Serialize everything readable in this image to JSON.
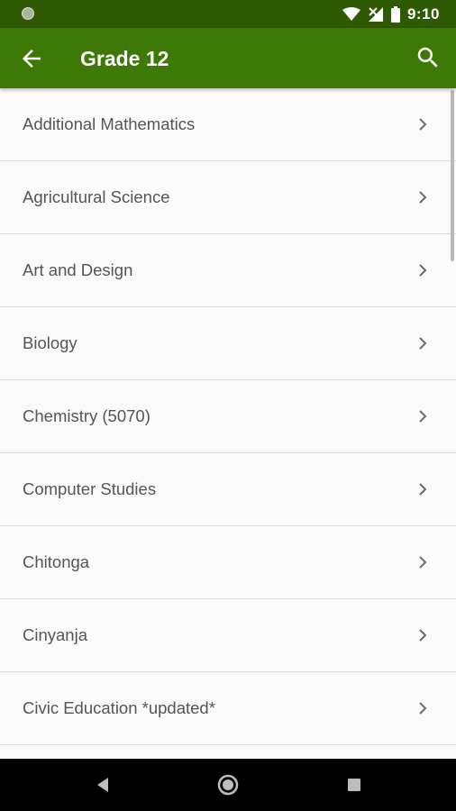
{
  "status_bar": {
    "time": "9:10"
  },
  "app_bar": {
    "title": "Grade 12",
    "back_icon": "arrow-back-icon",
    "search_icon": "search-icon"
  },
  "subjects": [
    {
      "label": "Additional Mathematics"
    },
    {
      "label": "Agricultural Science"
    },
    {
      "label": "Art and Design"
    },
    {
      "label": "Biology"
    },
    {
      "label": "Chemistry (5070)"
    },
    {
      "label": "Computer Studies"
    },
    {
      "label": "Chitonga"
    },
    {
      "label": "Cinyanja"
    },
    {
      "label": "Civic Education *updated*"
    },
    {
      "label": ""
    }
  ],
  "colors": {
    "status_bar": "#2e5a04",
    "app_bar": "#3e7806",
    "background": "#fafafa"
  }
}
